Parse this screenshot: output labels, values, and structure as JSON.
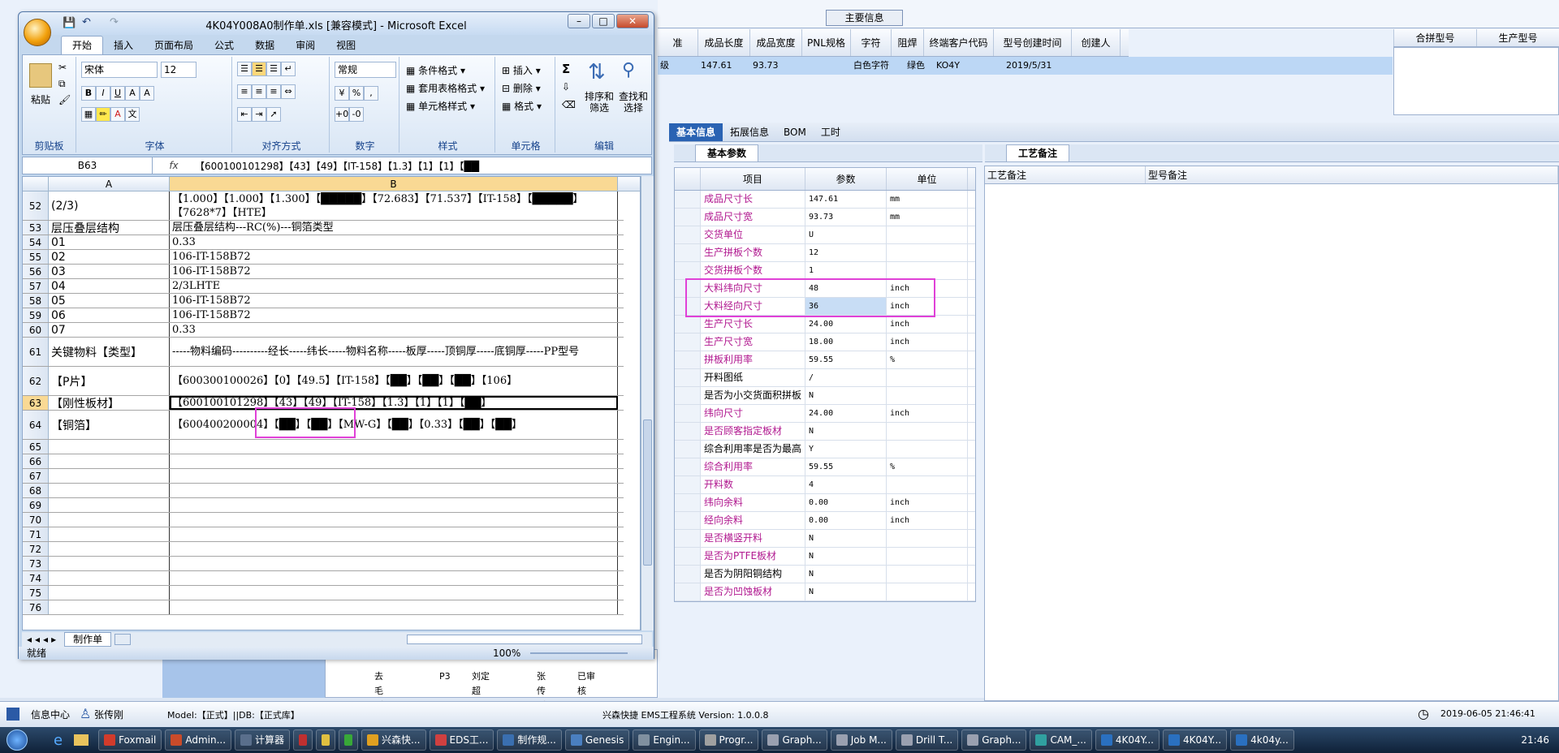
{
  "bg": {
    "main_info": "主要信息",
    "grid_headers": [
      "准",
      "成品长度",
      "成品宽度",
      "PNL规格",
      "字符",
      "阻焊",
      "终端客户代码",
      "型号创建时间",
      "创建人"
    ],
    "grid_row": [
      "级",
      "147.61",
      "93.73",
      "",
      "白色字符",
      "绿色",
      "KO4Y",
      "2019/5/31",
      ""
    ],
    "right_headers": [
      "合拼型号",
      "生产型号"
    ],
    "tabs": [
      "基本信息",
      "拓展信息",
      "BOM",
      "工时"
    ],
    "subtab_left": "基本参数",
    "subtab_right": "工艺备注",
    "param_headers": [
      "项目",
      "参数",
      "单位"
    ],
    "params": [
      {
        "item": "成品尺寸长",
        "value": "147.61",
        "unit": "mm",
        "pink": true
      },
      {
        "item": "成品尺寸宽",
        "value": "93.73",
        "unit": "mm",
        "pink": true
      },
      {
        "item": "交货单位",
        "value": "U",
        "unit": "",
        "pink": true
      },
      {
        "item": "生产拼板个数",
        "value": "12",
        "unit": "",
        "pink": true
      },
      {
        "item": "交货拼板个数",
        "value": "1",
        "unit": "",
        "pink": true
      },
      {
        "item": "大料纬向尺寸",
        "value": "48",
        "unit": "inch",
        "pink": true
      },
      {
        "item": "大料经向尺寸",
        "value": "36",
        "unit": "inch",
        "pink": true
      },
      {
        "item": "生产尺寸长",
        "value": "24.00",
        "unit": "inch",
        "pink": true
      },
      {
        "item": "生产尺寸宽",
        "value": "18.00",
        "unit": "inch",
        "pink": true
      },
      {
        "item": "拼板利用率",
        "value": "59.55",
        "unit": "%",
        "pink": true
      },
      {
        "item": "开料图纸",
        "value": "/",
        "unit": "",
        "pink": false
      },
      {
        "item": "是否为小交货面积拼板",
        "value": "N",
        "unit": "",
        "pink": false
      },
      {
        "item": "纬向尺寸",
        "value": "24.00",
        "unit": "inch",
        "pink": true
      },
      {
        "item": "是否顾客指定板材",
        "value": "N",
        "unit": "",
        "pink": true
      },
      {
        "item": "综合利用率是否为最高",
        "value": "Y",
        "unit": "",
        "pink": false
      },
      {
        "item": "综合利用率",
        "value": "59.55",
        "unit": "%",
        "pink": true
      },
      {
        "item": "开料数",
        "value": "4",
        "unit": "",
        "pink": true
      },
      {
        "item": "纬向余料",
        "value": "0.00",
        "unit": "inch",
        "pink": true
      },
      {
        "item": "经向余料",
        "value": "0.00",
        "unit": "inch",
        "pink": true
      },
      {
        "item": "是否横竖开料",
        "value": "N",
        "unit": "",
        "pink": true
      },
      {
        "item": "是否为PTFE板材",
        "value": "N",
        "unit": "",
        "pink": true
      },
      {
        "item": "是否为阴阳铜结构",
        "value": "N",
        "unit": "",
        "pink": false
      },
      {
        "item": "是否为凹蚀板材",
        "value": "N",
        "unit": "",
        "pink": true
      }
    ],
    "notes_headers": [
      "工艺备注",
      "型号备注"
    ],
    "tree_rows": [
      [
        "去毛刺",
        "P3",
        "刘定超",
        "张传刚",
        "已审核"
      ]
    ],
    "status_left": "信息中心",
    "status_user": "张传刚",
    "status_model": "Model:【正式】||DB:【正式库】",
    "status_app": "兴森快捷 EMS工程系统 Version: 1.0.0.8",
    "status_time": "2019-06-05 21:46:41"
  },
  "taskbar": {
    "items": [
      "Foxmail",
      "Admin...",
      "计算器",
      "",
      "",
      "",
      "兴森快...",
      "EDS工...",
      "制作规...",
      "Genesis",
      "Engin...",
      "Progr...",
      "Graph...",
      "Job M...",
      "Drill T...",
      "Graph...",
      "CAM_...",
      "4K04Y...",
      "4K04Y...",
      "4k04y..."
    ],
    "clock": "21:46"
  },
  "excel": {
    "title": "4K04Y008A0制作单.xls [兼容模式] - Microsoft Excel",
    "tabs": [
      "开始",
      "插入",
      "页面布局",
      "公式",
      "数据",
      "审阅",
      "视图"
    ],
    "ribbon": {
      "paste": "粘贴",
      "clipboard": "剪贴板",
      "font_name": "宋体",
      "font_size": "12",
      "font": "字体",
      "align": "对齐方式",
      "number_format": "常规",
      "number": "数字",
      "cond_format": "条件格式",
      "table_format": "套用表格格式",
      "cell_style": "单元格样式",
      "style": "样式",
      "insert": "插入",
      "delete": "删除",
      "format": "格式",
      "cells": "单元格",
      "sort_filter": "排序和筛选",
      "find_select": "查找和选择",
      "edit": "编辑"
    },
    "name_box": "B63",
    "formula": "【600100101298】【43】【49】【IT-158】【1.3】【1】【1】【██",
    "col_a": "A",
    "col_b": "B",
    "rows": [
      {
        "n": "52",
        "a": "(2/3)",
        "b": "【1.000】【1.000】【1.300】【█████】【72.683】【71.537】【IT-158】【█████】【7628*7】【HTE】",
        "h": 36
      },
      {
        "n": "53",
        "a": "层压叠层结构",
        "b": "层压叠层结构---RC(%)---铜箔类型",
        "h": 18
      },
      {
        "n": "54",
        "a": "01",
        "b": "0.33",
        "h": 18
      },
      {
        "n": "55",
        "a": "02",
        "b": "106-IT-158B72",
        "h": 18
      },
      {
        "n": "56",
        "a": "03",
        "b": "106-IT-158B72",
        "h": 18
      },
      {
        "n": "57",
        "a": "04",
        "b": "2/3LHTE",
        "h": 18
      },
      {
        "n": "58",
        "a": "05",
        "b": "106-IT-158B72",
        "h": 18
      },
      {
        "n": "59",
        "a": "06",
        "b": "106-IT-158B72",
        "h": 18
      },
      {
        "n": "60",
        "a": "07",
        "b": "0.33",
        "h": 18
      },
      {
        "n": "61",
        "a": "关键物料【类型】",
        "b": "-----物料编码----------经长-----纬长-----物料名称-----板厚-----顶铜厚-----底铜厚-----PP型号",
        "h": 36
      },
      {
        "n": "62",
        "a": "【P片】",
        "b": "【600300100026】【0】【49.5】【IT-158】【██】【██】【██】【106】",
        "h": 36
      },
      {
        "n": "63",
        "a": "【刚性板材】",
        "b": "【600100101298】【43】【49】【IT-158】【1.3】【1】【1】【██】",
        "h": 18
      },
      {
        "n": "64",
        "a": "【铜箔】",
        "b": "【600400200004】【██】【██】【MW-G】【██】【0.33】【██】【██】",
        "h": 36
      },
      {
        "n": "65",
        "a": "",
        "b": "",
        "h": 18
      },
      {
        "n": "66",
        "a": "",
        "b": "",
        "h": 18
      },
      {
        "n": "67",
        "a": "",
        "b": "",
        "h": 18
      },
      {
        "n": "68",
        "a": "",
        "b": "",
        "h": 18
      },
      {
        "n": "69",
        "a": "",
        "b": "",
        "h": 18
      },
      {
        "n": "70",
        "a": "",
        "b": "",
        "h": 18
      },
      {
        "n": "71",
        "a": "",
        "b": "",
        "h": 18
      },
      {
        "n": "72",
        "a": "",
        "b": "",
        "h": 18
      },
      {
        "n": "73",
        "a": "",
        "b": "",
        "h": 18
      },
      {
        "n": "74",
        "a": "",
        "b": "",
        "h": 18
      },
      {
        "n": "75",
        "a": "",
        "b": "",
        "h": 18
      },
      {
        "n": "76",
        "a": "",
        "b": "",
        "h": 18
      }
    ],
    "sheet_tab": "制作单",
    "status": "就绪",
    "zoom": "100%"
  }
}
